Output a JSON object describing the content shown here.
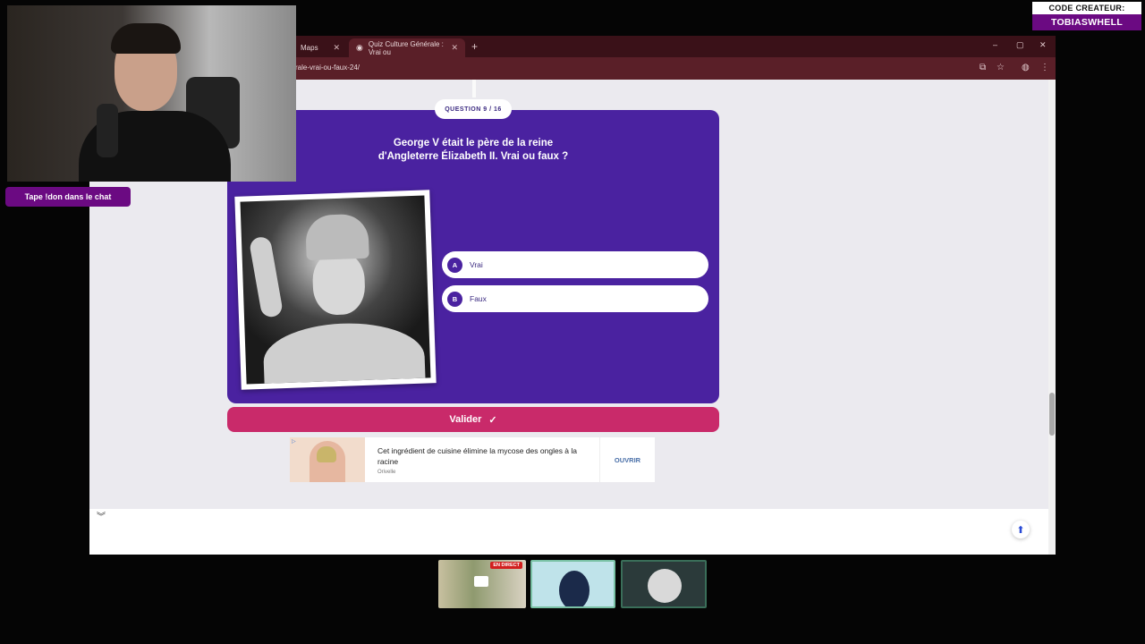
{
  "browser": {
    "tabs": [
      {
        "label": "Maps",
        "active": false
      },
      {
        "label": "Quiz Culture Générale : Vrai ou",
        "active": true
      }
    ],
    "url": "rale-vrai-ou-faux-24/"
  },
  "quiz": {
    "badge": "QUESTION 9 / 16",
    "question_line1": "George V était le père de la reine",
    "question_line2": "d'Angleterre Élizabeth II. Vrai ou faux ?",
    "answers": [
      {
        "letter": "A",
        "label": "Vrai"
      },
      {
        "letter": "B",
        "label": "Faux"
      }
    ],
    "validate_label": "Valider",
    "validate_icon": "✓"
  },
  "ad": {
    "title": "Cet ingrédient de cuisine élimine la mycose des ongles à la racine",
    "source": "Orivelle",
    "cta": "OUVRIR"
  },
  "overlay": {
    "chat_prompt": "Tape !don dans le chat",
    "creator_top": "CODE CREATEUR:",
    "creator_name": "TOBIASWHELL",
    "live_label": "EN DIRECT"
  },
  "colors": {
    "quiz_bg": "#4a22a0",
    "validate_bg": "#c92a6a",
    "overlay_purple": "#6b0a82"
  }
}
